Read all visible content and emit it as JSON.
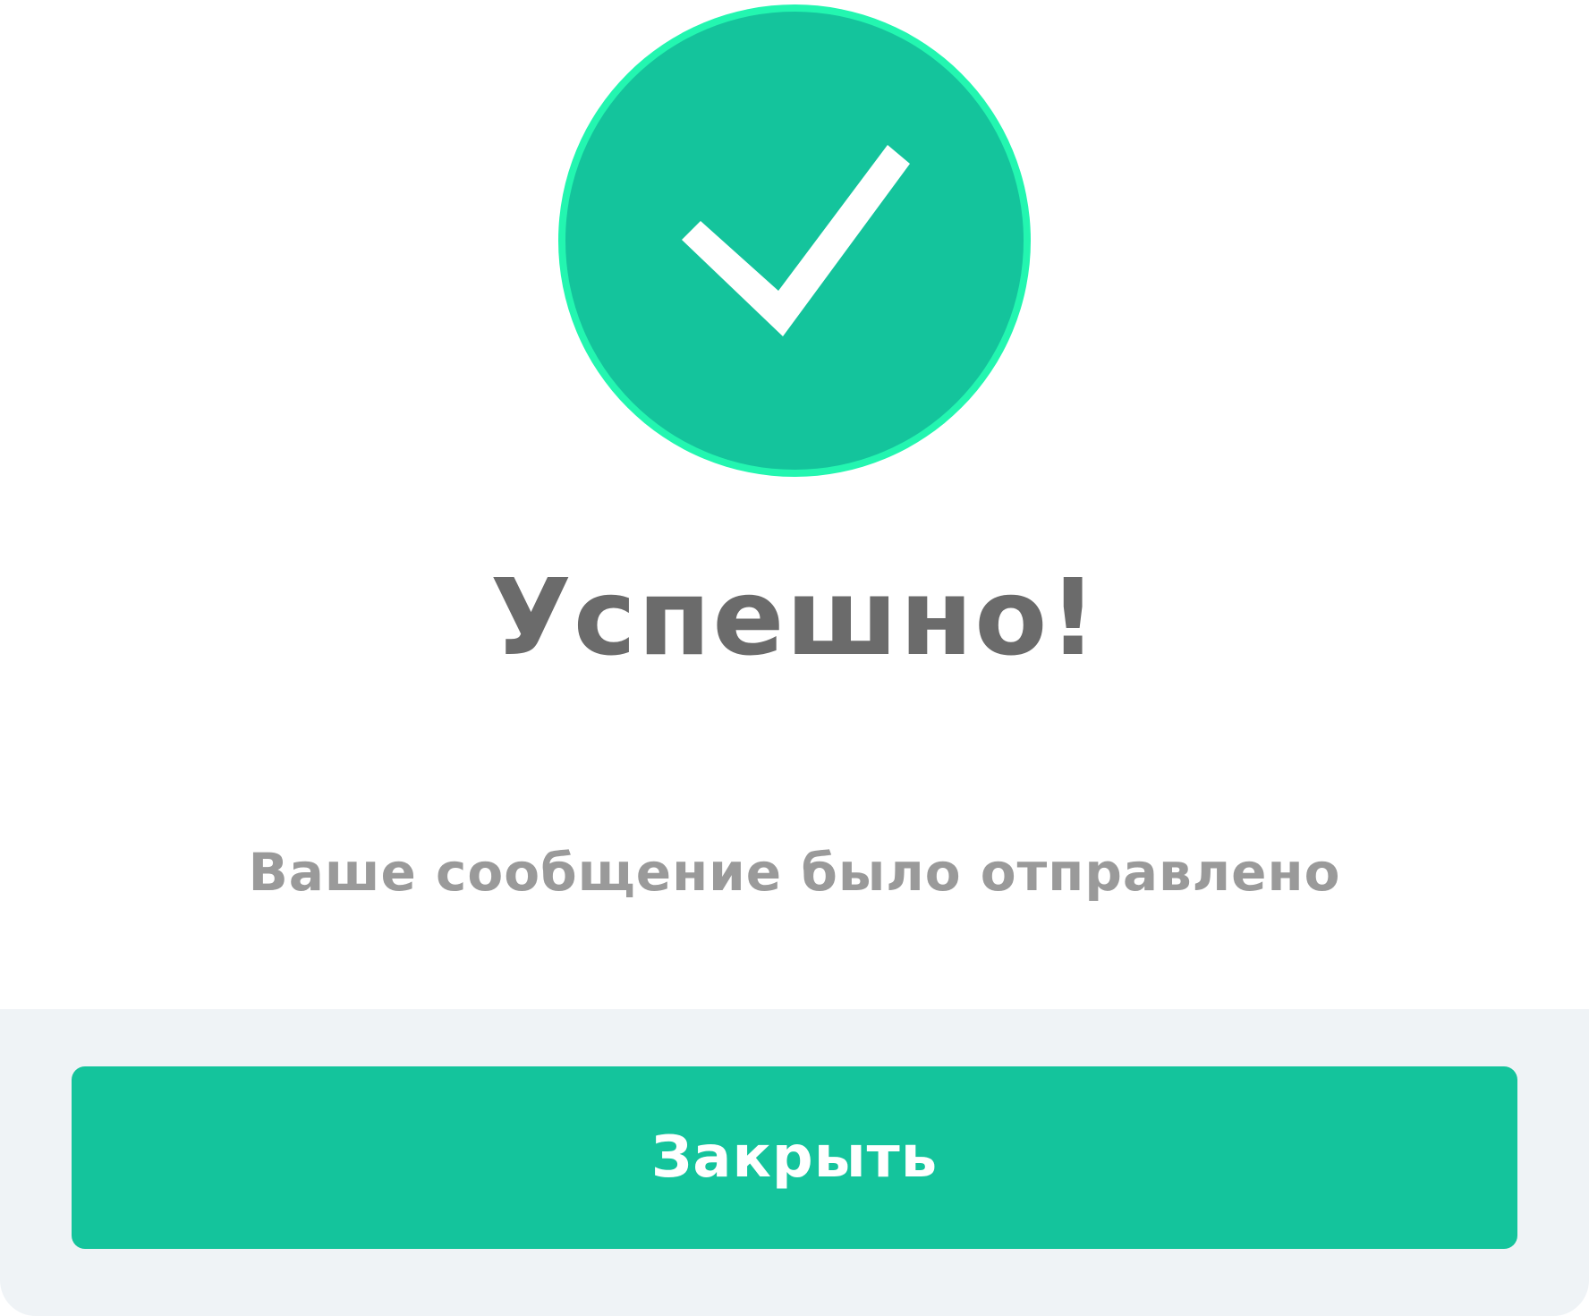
{
  "dialog": {
    "icon": "checkmark-icon",
    "title": "Успешно!",
    "message": "Ваше сообщение было отправлено",
    "close_label": "Закрыть"
  },
  "colors": {
    "accent": "#14c49c",
    "accent_ring": "#23f6b0",
    "title_text": "#6b6b6b",
    "message_text": "#9a9a9a",
    "footer_bg": "#eff3f6",
    "button_text": "#ffffff"
  }
}
